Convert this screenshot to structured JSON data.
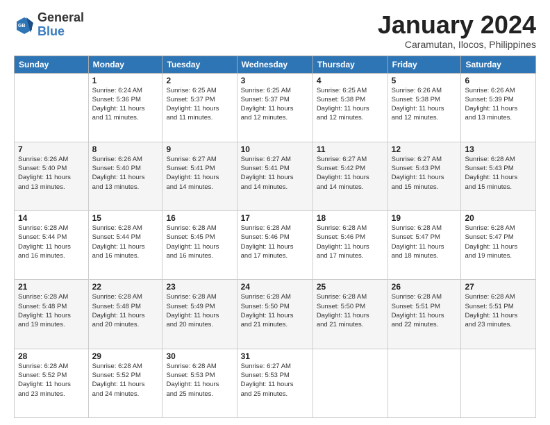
{
  "logo": {
    "general": "General",
    "blue": "Blue"
  },
  "header": {
    "month": "January 2024",
    "location": "Caramutan, Ilocos, Philippines"
  },
  "weekdays": [
    "Sunday",
    "Monday",
    "Tuesday",
    "Wednesday",
    "Thursday",
    "Friday",
    "Saturday"
  ],
  "weeks": [
    [
      {
        "day": "",
        "info": ""
      },
      {
        "day": "1",
        "info": "Sunrise: 6:24 AM\nSunset: 5:36 PM\nDaylight: 11 hours\nand 11 minutes."
      },
      {
        "day": "2",
        "info": "Sunrise: 6:25 AM\nSunset: 5:37 PM\nDaylight: 11 hours\nand 11 minutes."
      },
      {
        "day": "3",
        "info": "Sunrise: 6:25 AM\nSunset: 5:37 PM\nDaylight: 11 hours\nand 12 minutes."
      },
      {
        "day": "4",
        "info": "Sunrise: 6:25 AM\nSunset: 5:38 PM\nDaylight: 11 hours\nand 12 minutes."
      },
      {
        "day": "5",
        "info": "Sunrise: 6:26 AM\nSunset: 5:38 PM\nDaylight: 11 hours\nand 12 minutes."
      },
      {
        "day": "6",
        "info": "Sunrise: 6:26 AM\nSunset: 5:39 PM\nDaylight: 11 hours\nand 13 minutes."
      }
    ],
    [
      {
        "day": "7",
        "info": "Sunrise: 6:26 AM\nSunset: 5:40 PM\nDaylight: 11 hours\nand 13 minutes."
      },
      {
        "day": "8",
        "info": "Sunrise: 6:26 AM\nSunset: 5:40 PM\nDaylight: 11 hours\nand 13 minutes."
      },
      {
        "day": "9",
        "info": "Sunrise: 6:27 AM\nSunset: 5:41 PM\nDaylight: 11 hours\nand 14 minutes."
      },
      {
        "day": "10",
        "info": "Sunrise: 6:27 AM\nSunset: 5:41 PM\nDaylight: 11 hours\nand 14 minutes."
      },
      {
        "day": "11",
        "info": "Sunrise: 6:27 AM\nSunset: 5:42 PM\nDaylight: 11 hours\nand 14 minutes."
      },
      {
        "day": "12",
        "info": "Sunrise: 6:27 AM\nSunset: 5:43 PM\nDaylight: 11 hours\nand 15 minutes."
      },
      {
        "day": "13",
        "info": "Sunrise: 6:28 AM\nSunset: 5:43 PM\nDaylight: 11 hours\nand 15 minutes."
      }
    ],
    [
      {
        "day": "14",
        "info": "Sunrise: 6:28 AM\nSunset: 5:44 PM\nDaylight: 11 hours\nand 16 minutes."
      },
      {
        "day": "15",
        "info": "Sunrise: 6:28 AM\nSunset: 5:44 PM\nDaylight: 11 hours\nand 16 minutes."
      },
      {
        "day": "16",
        "info": "Sunrise: 6:28 AM\nSunset: 5:45 PM\nDaylight: 11 hours\nand 16 minutes."
      },
      {
        "day": "17",
        "info": "Sunrise: 6:28 AM\nSunset: 5:46 PM\nDaylight: 11 hours\nand 17 minutes."
      },
      {
        "day": "18",
        "info": "Sunrise: 6:28 AM\nSunset: 5:46 PM\nDaylight: 11 hours\nand 17 minutes."
      },
      {
        "day": "19",
        "info": "Sunrise: 6:28 AM\nSunset: 5:47 PM\nDaylight: 11 hours\nand 18 minutes."
      },
      {
        "day": "20",
        "info": "Sunrise: 6:28 AM\nSunset: 5:47 PM\nDaylight: 11 hours\nand 19 minutes."
      }
    ],
    [
      {
        "day": "21",
        "info": "Sunrise: 6:28 AM\nSunset: 5:48 PM\nDaylight: 11 hours\nand 19 minutes."
      },
      {
        "day": "22",
        "info": "Sunrise: 6:28 AM\nSunset: 5:48 PM\nDaylight: 11 hours\nand 20 minutes."
      },
      {
        "day": "23",
        "info": "Sunrise: 6:28 AM\nSunset: 5:49 PM\nDaylight: 11 hours\nand 20 minutes."
      },
      {
        "day": "24",
        "info": "Sunrise: 6:28 AM\nSunset: 5:50 PM\nDaylight: 11 hours\nand 21 minutes."
      },
      {
        "day": "25",
        "info": "Sunrise: 6:28 AM\nSunset: 5:50 PM\nDaylight: 11 hours\nand 21 minutes."
      },
      {
        "day": "26",
        "info": "Sunrise: 6:28 AM\nSunset: 5:51 PM\nDaylight: 11 hours\nand 22 minutes."
      },
      {
        "day": "27",
        "info": "Sunrise: 6:28 AM\nSunset: 5:51 PM\nDaylight: 11 hours\nand 23 minutes."
      }
    ],
    [
      {
        "day": "28",
        "info": "Sunrise: 6:28 AM\nSunset: 5:52 PM\nDaylight: 11 hours\nand 23 minutes."
      },
      {
        "day": "29",
        "info": "Sunrise: 6:28 AM\nSunset: 5:52 PM\nDaylight: 11 hours\nand 24 minutes."
      },
      {
        "day": "30",
        "info": "Sunrise: 6:28 AM\nSunset: 5:53 PM\nDaylight: 11 hours\nand 25 minutes."
      },
      {
        "day": "31",
        "info": "Sunrise: 6:27 AM\nSunset: 5:53 PM\nDaylight: 11 hours\nand 25 minutes."
      },
      {
        "day": "",
        "info": ""
      },
      {
        "day": "",
        "info": ""
      },
      {
        "day": "",
        "info": ""
      }
    ]
  ]
}
